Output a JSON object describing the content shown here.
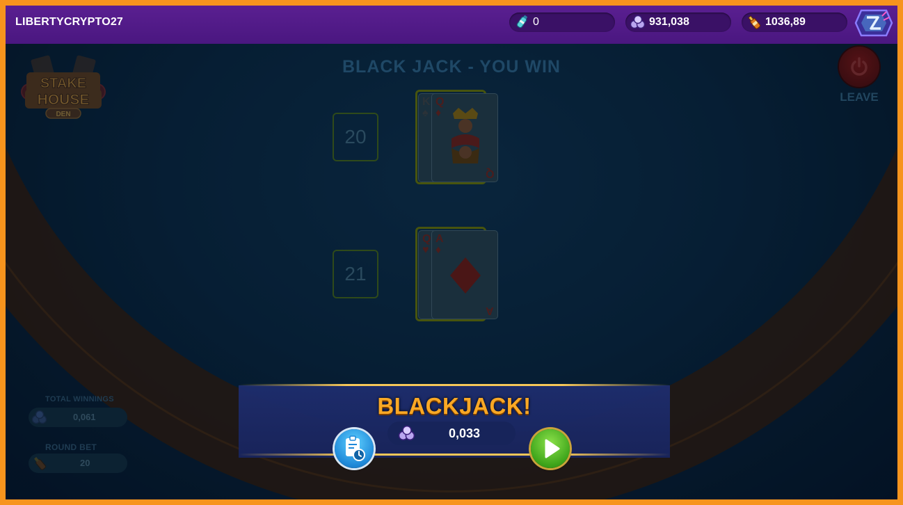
{
  "header": {
    "username": "LIBERTYCRYPTO27",
    "balances": [
      {
        "icon": "gem-bottle-icon",
        "value": "0"
      },
      {
        "icon": "coins-icon",
        "value": "931,038"
      },
      {
        "icon": "bottle-icon",
        "value": "1036,89"
      }
    ],
    "brand_icon": "brand-logo-icon"
  },
  "game": {
    "logo_text": "STAKE HOUSE",
    "logo_sub": "DEN",
    "result_title": "BLACK JACK - YOU WIN",
    "leave_label": "LEAVE",
    "dealer": {
      "score": "20",
      "cards": [
        {
          "rank": "K",
          "suit": "♠"
        },
        {
          "rank": "Q",
          "suit": "♦"
        }
      ]
    },
    "player": {
      "score": "21",
      "cards": [
        {
          "rank": "Q",
          "suit": "♥"
        },
        {
          "rank": "A",
          "suit": "♦"
        }
      ]
    }
  },
  "stats": {
    "total_winnings_label": "TOTAL WINNINGS",
    "total_winnings_value": "0,061",
    "round_bet_label": "ROUND BET",
    "round_bet_value": "20"
  },
  "banner": {
    "title": "BLACKJACK!",
    "win_amount": "0,033",
    "history_icon": "bet-history-icon",
    "next_icon": "play-icon"
  },
  "colors": {
    "frame": "#f7941d",
    "topbar": "#4a1780",
    "banner_title": "#f9a825",
    "accent_gold": "#f6c758"
  }
}
